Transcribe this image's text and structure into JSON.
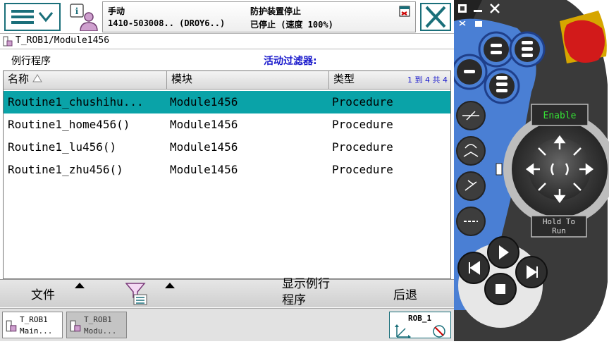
{
  "status": {
    "mode": "手动",
    "controller": "1410-503008..  (DROY6..)",
    "safety": "防护装置停止",
    "state": "已停止 (速度 100%)"
  },
  "path": {
    "label": "T_ROB1/Module1456"
  },
  "list": {
    "title": "例行程序",
    "filter_label": "活动过滤器:",
    "col_name": "名称",
    "col_module": "模块",
    "col_type": "类型",
    "range": "1 到 4 共 4",
    "rows": [
      {
        "name": "Routine1_chushihu...",
        "module": "Module1456",
        "type": "Procedure"
      },
      {
        "name": "Routine1_home456()",
        "module": "Module1456",
        "type": "Procedure"
      },
      {
        "name": "Routine1_lu456()",
        "module": "Module1456",
        "type": "Procedure"
      },
      {
        "name": "Routine1_zhu456()",
        "module": "Module1456",
        "type": "Procedure"
      }
    ]
  },
  "commands": {
    "file": "文件",
    "show_1": "显示例行",
    "show_2": "程序",
    "back": "后退"
  },
  "taskbar": {
    "task1_line1": "T_ROB1",
    "task1_line2": "Main...",
    "task2_line1": "T_ROB1",
    "task2_line2": "Modu...",
    "rob": "ROB_1"
  },
  "flexpendant": {
    "enable_label": "Enable",
    "hold_line1": "Hold To",
    "hold_line2": "Run"
  },
  "colors": {
    "accent": "#1a6f7a",
    "selection": "#0aa3a8",
    "pendant_blue": "#4a7fd4"
  }
}
